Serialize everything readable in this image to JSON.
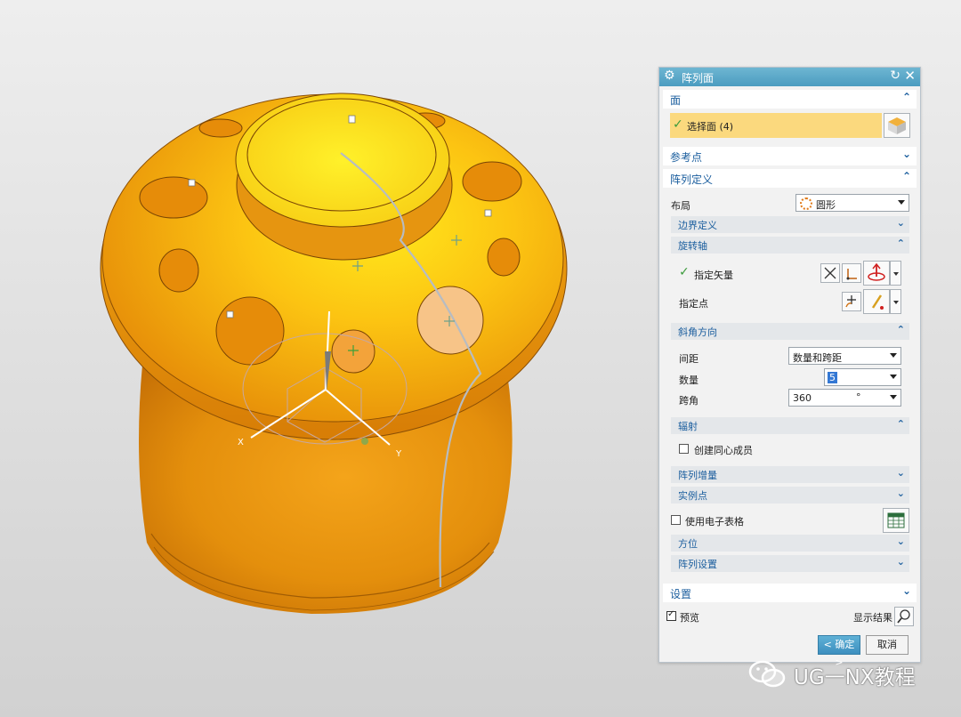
{
  "dialog": {
    "title": "阵列面",
    "sections": {
      "face": {
        "label": "面",
        "select_label": "选择面 (4)"
      },
      "ref_point": {
        "label": "参考点"
      },
      "pattern_def": {
        "label": "阵列定义",
        "layout_label": "布局",
        "layout_value": "圆形",
        "boundary": {
          "label": "边界定义"
        },
        "rot_axis": {
          "label": "旋转轴",
          "vector_label": "指定矢量",
          "point_label": "指定点"
        },
        "angular": {
          "label": "斜角方向",
          "spacing_label": "间距",
          "spacing_value": "数量和跨距",
          "count_label": "数量",
          "count_value": "5",
          "span_label": "跨角",
          "span_value": "360",
          "span_unit": "°"
        },
        "radiate": {
          "label": "辐射",
          "concentric_label": "创建同心成员"
        },
        "increment": {
          "label": "阵列增量"
        },
        "instance": {
          "label": "实例点"
        },
        "spreadsheet_label": "使用电子表格",
        "orientation": {
          "label": "方位"
        },
        "settings": {
          "label": "阵列设置"
        }
      },
      "settings": {
        "label": "设置"
      }
    },
    "preview_label": "预览",
    "show_result_label": "显示结果",
    "ok_label": "< 确定 >",
    "cancel_label": "取消"
  },
  "viewport": {
    "axis_x": "X",
    "axis_y": "Y"
  },
  "watermark": {
    "text": "UG一NX教程"
  }
}
